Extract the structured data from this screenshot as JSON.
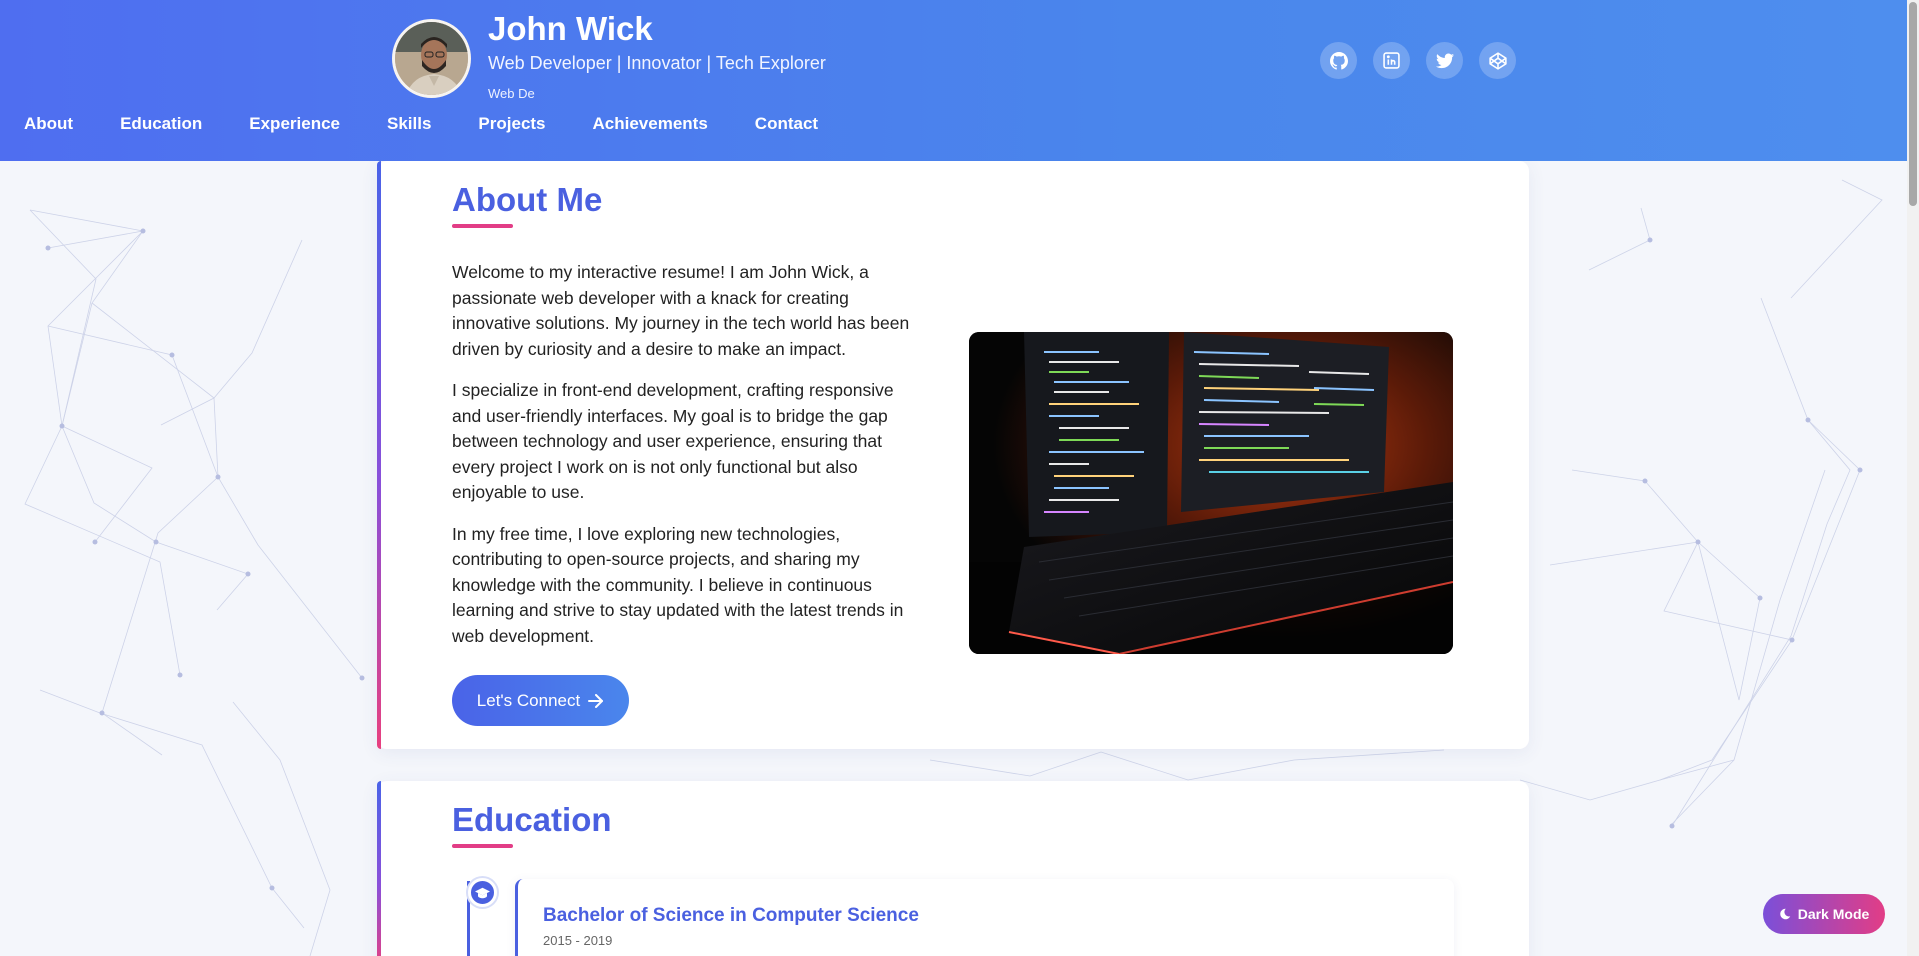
{
  "profile": {
    "name": "John Wick",
    "tagline": "Web Developer | Innovator | Tech Explorer",
    "typing_text": "Web De"
  },
  "socials": [
    {
      "icon": "github-icon"
    },
    {
      "icon": "linkedin-icon"
    },
    {
      "icon": "twitter-icon"
    },
    {
      "icon": "codepen-icon"
    }
  ],
  "nav": [
    "About",
    "Education",
    "Experience",
    "Skills",
    "Projects",
    "Achievements",
    "Contact"
  ],
  "about": {
    "title": "About Me",
    "paragraphs": [
      "Welcome to my interactive resume! I am John Wick, a passionate web developer with a knack for creating innovative solutions. My journey in the tech world has been driven by curiosity and a desire to make an impact.",
      "I specialize in front-end development, crafting responsive and user-friendly interfaces. My goal is to bridge the gap between technology and user experience, ensuring that every project I work on is not only functional but also enjoyable to use.",
      "In my free time, I love exploring new technologies, contributing to open-source projects, and sharing my knowledge with the community. I believe in continuous learning and strive to stay updated with the latest trends in web development."
    ],
    "cta_label": "Let's Connect"
  },
  "education": {
    "title": "Education",
    "items": [
      {
        "degree": "Bachelor of Science in Computer Science",
        "years": "2015 - 2019"
      }
    ]
  },
  "theme_toggle_label": "Dark Mode",
  "colors": {
    "primary": "#4a60e0",
    "accent": "#e23d86",
    "header_gradient_start": "#4f6ef0",
    "header_gradient_end": "#4e8eee"
  }
}
